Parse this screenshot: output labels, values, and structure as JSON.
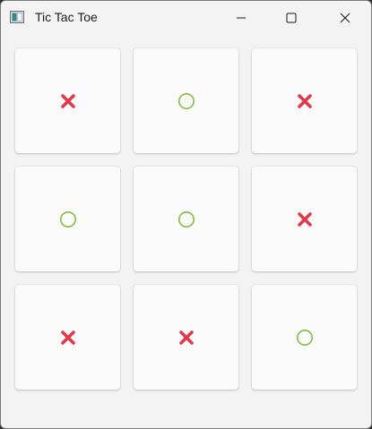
{
  "window": {
    "title": "Tic Tac Toe",
    "controls": {
      "minimize_icon": "minimize-icon",
      "maximize_icon": "maximize-icon",
      "close_icon": "close-icon"
    }
  },
  "colors": {
    "x_mark": "#e23a4a",
    "o_mark": "#86bb45",
    "cell_background": "#fbfbfb",
    "window_background": "#f3f3f3"
  },
  "board": {
    "rows": [
      [
        "X",
        "O",
        "X"
      ],
      [
        "O",
        "O",
        "X"
      ],
      [
        "X",
        "X",
        "O"
      ]
    ]
  }
}
